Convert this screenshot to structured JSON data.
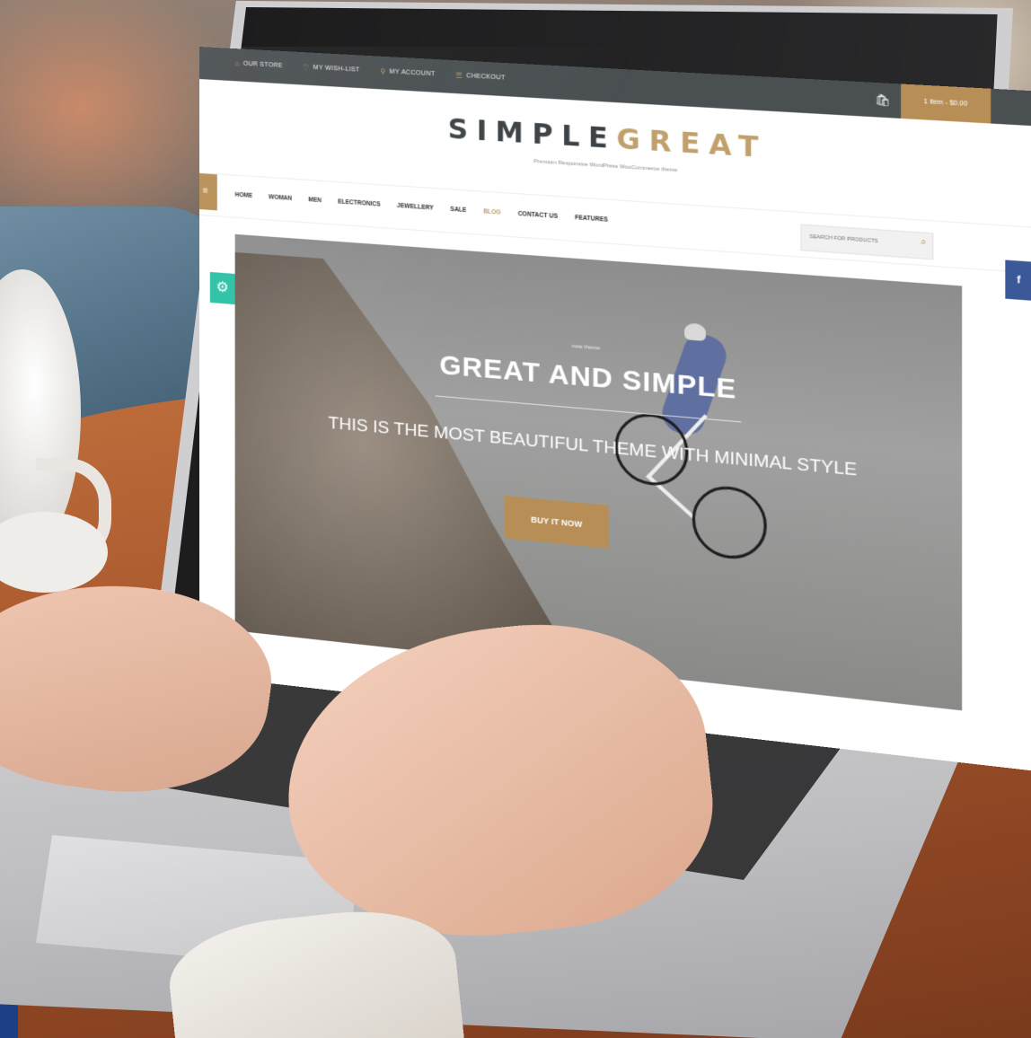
{
  "topbar": {
    "links": [
      {
        "label": "OUR STORE",
        "icon": "store-icon"
      },
      {
        "label": "MY WISH-LIST",
        "icon": "heart-icon"
      },
      {
        "label": "MY ACCOUNT",
        "icon": "user-icon"
      },
      {
        "label": "CHECKOUT",
        "icon": "checkout-icon"
      }
    ],
    "cart_label": "1 item - $0.00"
  },
  "logo": {
    "part1": "SIMPLE",
    "part2": "GREAT"
  },
  "tagline": "Premium Responsive WordPress WooCommerce theme",
  "nav": {
    "items": [
      "HOME",
      "WOMAN",
      "MEN",
      "ELECTRONICS",
      "JEWELLERY",
      "SALE",
      "BLOG",
      "CONTACT US",
      "FEATURES"
    ],
    "active": "BLOG"
  },
  "search": {
    "placeholder": "SEARCH FOR PRODUCTS"
  },
  "hero": {
    "eyebrow": "new theme",
    "title": "GREAT AND SIMPLE",
    "subtitle": "THIS IS THE MOST BEAUTIFUL THEME WITH MINIMAL STYLE",
    "button": "BUY IT NOW"
  },
  "social": {
    "facebook": "f"
  },
  "colors": {
    "accent": "#b78e55",
    "topbar": "#4a4f52",
    "teal": "#2bc1a5",
    "facebook": "#3b5998"
  }
}
